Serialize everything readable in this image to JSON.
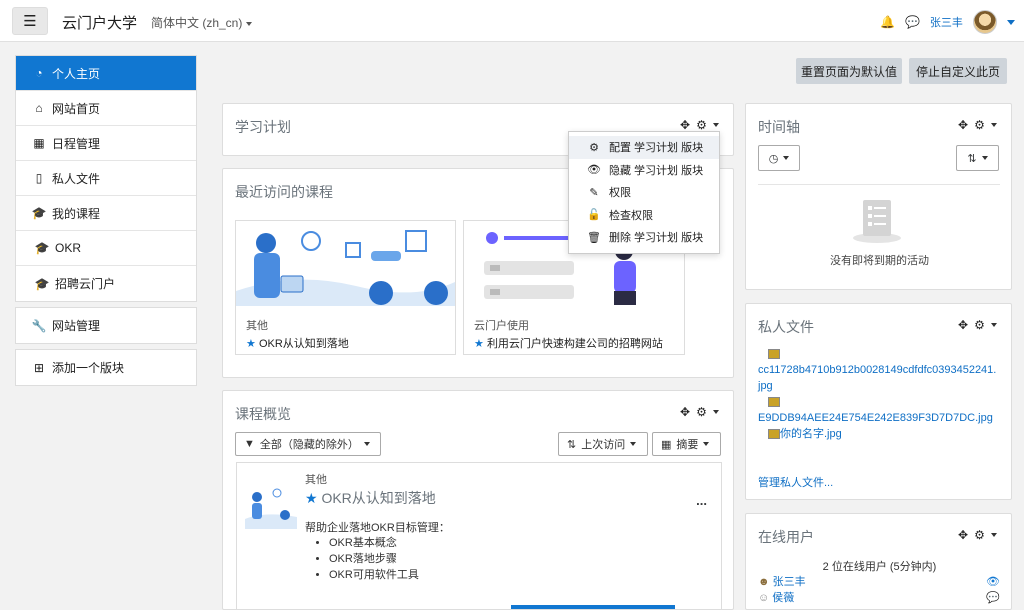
{
  "navbar": {
    "site_name": "云门户大学",
    "language": "简体中文 (zh_cn)",
    "username": "张三丰"
  },
  "drawer": {
    "items": [
      {
        "label": "个人主页",
        "icon": "dashboard-icon"
      },
      {
        "label": "网站首页",
        "icon": "home-icon"
      },
      {
        "label": "日程管理",
        "icon": "calendar-icon"
      },
      {
        "label": "私人文件",
        "icon": "file-icon"
      },
      {
        "label": "我的课程",
        "icon": "graduation-cap-icon"
      },
      {
        "label": "OKR",
        "icon": "graduation-cap-icon"
      },
      {
        "label": "招聘云门户",
        "icon": "graduation-cap-icon"
      }
    ],
    "admin": "网站管理",
    "add_block": "添加一个版块"
  },
  "page_buttons": {
    "reset": "重置页面为默认值",
    "stop_customize": "停止自定义此页"
  },
  "learning_plan": {
    "title": "学习计划"
  },
  "dropdown": {
    "items": [
      {
        "label": "配置 学习计划 版块",
        "icon": "gear-icon"
      },
      {
        "label": "隐藏 学习计划 版块",
        "icon": "eye-icon"
      },
      {
        "label": "权限",
        "icon": "edit-icon"
      },
      {
        "label": "检查权限",
        "icon": "unlock-icon"
      },
      {
        "label": "删除 学习计划 版块",
        "icon": "trash-icon"
      }
    ]
  },
  "recent_courses": {
    "title": "最近访问的课程",
    "cards": [
      {
        "category": "其他",
        "title": "OKR从认知到落地"
      },
      {
        "category": "云门户使用",
        "title": "利用云门户快速构建公司的招聘网站"
      }
    ]
  },
  "course_overview": {
    "title": "课程概览",
    "filter_all": "全部（隐藏的除外）",
    "sort": "上次访问",
    "view": "摘要",
    "course": {
      "category": "其他",
      "name": "OKR从认知到落地",
      "summary": "帮助企业落地OKR目标管理：",
      "bullets": [
        "OKR基本概念",
        "OKR落地步骤",
        "OKR可用软件工具"
      ],
      "more": "..."
    }
  },
  "timeline": {
    "title": "时间轴",
    "empty": "没有即将到期的活动"
  },
  "private_files": {
    "title": "私人文件",
    "files": [
      "cc11728b4710b912b0028149cdfdfc0393452241.jpg",
      "E9DDB94AEE24E754E242E839F3D7D7DC.jpg",
      "你的名字.jpg"
    ],
    "manage": "管理私人文件..."
  },
  "online_users": {
    "title": "在线用户",
    "summary": "2 位在线用户 (5分钟内)",
    "users": [
      "张三丰",
      "侯薇"
    ]
  },
  "colors": {
    "primary": "#1177d1",
    "link": "#0f6fc5"
  }
}
